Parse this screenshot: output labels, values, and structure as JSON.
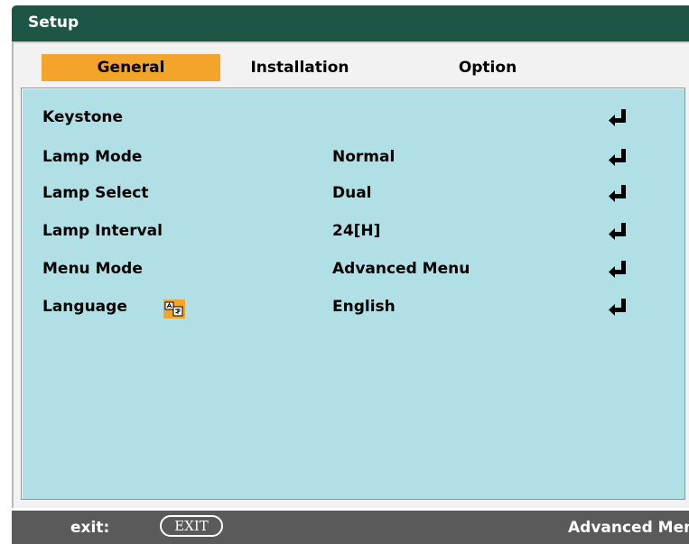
{
  "window": {
    "title": "Setup"
  },
  "tabs": [
    {
      "label": "General",
      "active": true
    },
    {
      "label": "Installation",
      "active": false
    },
    {
      "label": "Option",
      "active": false
    }
  ],
  "rows": [
    {
      "label": "Keystone",
      "value": ""
    },
    {
      "label": "Lamp Mode",
      "value": "Normal"
    },
    {
      "label": "Lamp Select",
      "value": "Dual"
    },
    {
      "label": "Lamp Interval",
      "value": "24[H]"
    },
    {
      "label": "Menu Mode",
      "value": "Advanced Menu"
    },
    {
      "label": "Language",
      "value": "English"
    }
  ],
  "icons": {
    "enter": "enter-return-icon",
    "language": "language-icon"
  },
  "status": {
    "exit_label": "exit:",
    "exit_key": "EXIT",
    "mode": "Advanced Menu"
  },
  "colors": {
    "titlebar": "#1d5646",
    "active_tab": "#f2a52a",
    "panel": "#b0e0e6",
    "statusbar": "#5a5a5a"
  }
}
